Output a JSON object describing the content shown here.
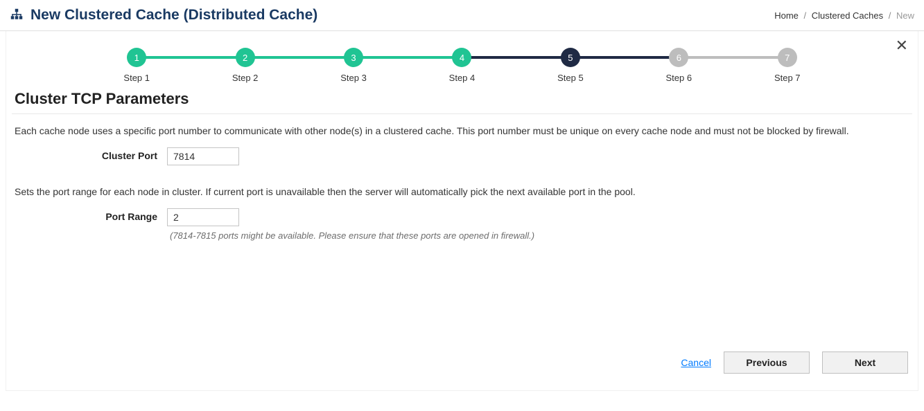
{
  "header": {
    "title": "New Clustered Cache (Distributed Cache)",
    "breadcrumb": {
      "home": "Home",
      "mid": "Clustered Caches",
      "current": "New"
    }
  },
  "stepper": {
    "steps": [
      {
        "num": "1",
        "label": "Step 1",
        "circle": "green",
        "bar": "green"
      },
      {
        "num": "2",
        "label": "Step 2",
        "circle": "green",
        "bar": "green"
      },
      {
        "num": "3",
        "label": "Step 3",
        "circle": "green",
        "bar": "green"
      },
      {
        "num": "4",
        "label": "Step 4",
        "circle": "green",
        "bar": "navy"
      },
      {
        "num": "5",
        "label": "Step 5",
        "circle": "navy",
        "bar": "navy"
      },
      {
        "num": "6",
        "label": "Step 6",
        "circle": "grey",
        "bar": "grey"
      },
      {
        "num": "7",
        "label": "Step 7",
        "circle": "grey",
        "bar": ""
      }
    ]
  },
  "section": {
    "title": "Cluster TCP Parameters",
    "desc1": "Each cache node uses a specific port number to communicate with other node(s) in a clustered cache. This port number must be unique on every cache node and must not be blocked by firewall.",
    "cluster_port_label": "Cluster Port",
    "cluster_port_value": "7814",
    "desc2": "Sets the port range for each node in cluster. If current port is unavailable then the server will automatically pick the next available port in the pool.",
    "port_range_label": "Port Range",
    "port_range_value": "2",
    "hint": "(7814-7815 ports might be available. Please ensure that these ports are opened in firewall.)"
  },
  "footer": {
    "cancel": "Cancel",
    "previous": "Previous",
    "next": "Next"
  },
  "close_glyph": "✕"
}
